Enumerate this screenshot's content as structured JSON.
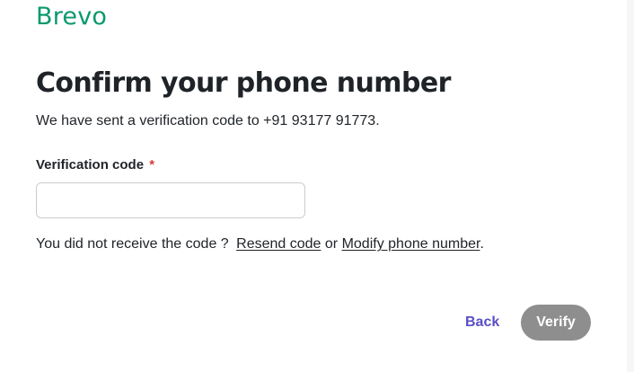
{
  "brand": {
    "logo_text": "Brevo",
    "color": "#0b996e"
  },
  "header": {
    "title": "Confirm your phone number",
    "subtitle": "We have sent a verification code to +91 93177 91773."
  },
  "form": {
    "code_label": "Verification code",
    "required_marker": "*",
    "code_value": "",
    "code_placeholder": ""
  },
  "help": {
    "prefix": "You did not receive the code ?",
    "resend_link": "Resend code",
    "or_text": "or",
    "modify_link": "Modify phone number",
    "suffix": "."
  },
  "actions": {
    "back_label": "Back",
    "verify_label": "Verify",
    "back_color": "#5b4fc7",
    "verify_bg": "#8e8e8e"
  }
}
